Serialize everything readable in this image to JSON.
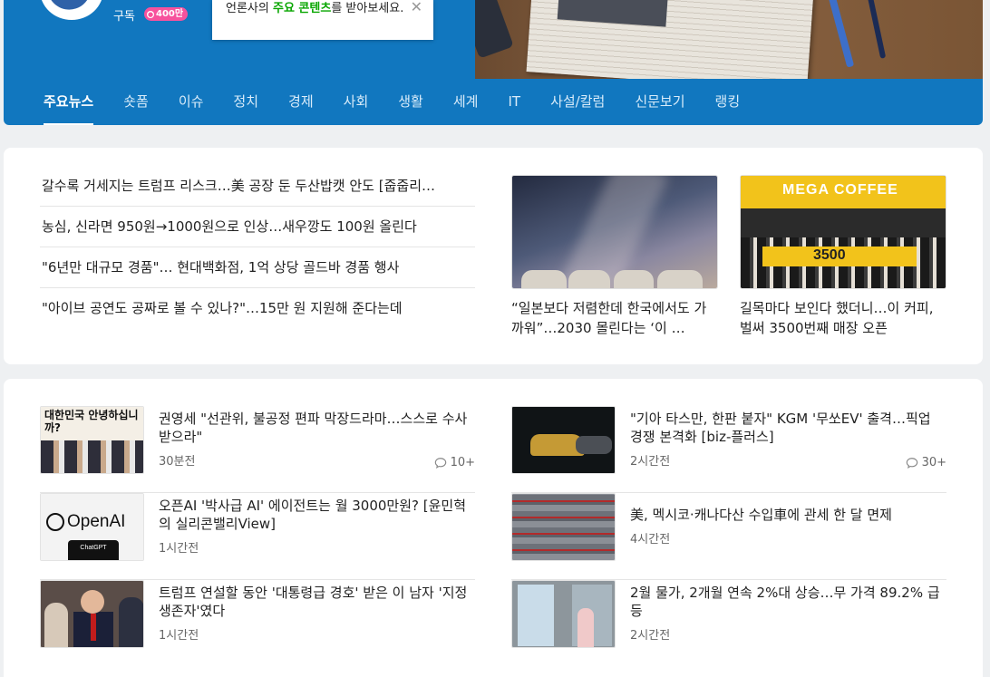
{
  "header": {
    "subscribe_label": "구독",
    "subscriber_count": "400만",
    "tooltip": {
      "prefix": "언론사의 ",
      "highlight": "주요 콘텐츠",
      "suffix": "를 받아보세요."
    },
    "tabs": [
      {
        "label": "주요뉴스",
        "active": true
      },
      {
        "label": "숏폼"
      },
      {
        "label": "이슈"
      },
      {
        "label": "정치"
      },
      {
        "label": "경제"
      },
      {
        "label": "사회"
      },
      {
        "label": "생활"
      },
      {
        "label": "세계"
      },
      {
        "label": "IT"
      },
      {
        "label": "사설/칼럼"
      },
      {
        "label": "신문보기"
      },
      {
        "label": "랭킹"
      }
    ]
  },
  "top_news": {
    "headlines": [
      "갈수록 거세지는 트럼프 리스크…美 공장 둔 두산밥캣 안도 [줍줍리…",
      "농심, 신라면 950원→1000원으로 인상…새우깡도 100원 올린다",
      "\"6년만 대규모 경품\"… 현대백화점, 1억 상당 골드바 경품 행사",
      "\"아이브 공연도 공짜로 볼 수 있나?\"…15만 원 지원해 준다는데"
    ],
    "photo_cards": [
      {
        "caption": "“일본보다 저렴한데 한국에서도 가까워”…2030 몰린다는 ‘이 …"
      },
      {
        "caption": "길목마다 보인다 했더니…이 커피, 벌써 3500번째 매장 오픈",
        "sign": "MEGA COFFEE",
        "banner": "3500"
      }
    ]
  },
  "articles": {
    "left": [
      {
        "title": "권영세 \"선관위, 불공정 편파 막장드라마…스스로 수사 받으라\"",
        "time": "30분전",
        "comments": "10+",
        "thumb_text": "대한민국 안녕하십니까?"
      },
      {
        "title": "오픈AI '박사급 AI' 에이전트는 월 3000만원? [윤민혁의 실리콘밸리View]",
        "time": "1시간전",
        "thumb_logo": "OpenAI",
        "thumb_phone": "ChatGPT"
      },
      {
        "title": "트럼프 연설할 동안 '대통령급 경호' 받은 이 남자 '지정 생존자'였다",
        "time": "1시간전"
      }
    ],
    "right": [
      {
        "title": "\"기아 타스만, 한판 붙자\" KGM '무쏘EV' 출격…픽업 경쟁 본격화 [biz-플러스]",
        "time": "2시간전",
        "comments": "30+"
      },
      {
        "title": "美, 멕시코·캐나다산 수입車에 관세 한 달 면제",
        "time": "4시간전"
      },
      {
        "title": "2월 물가, 2개월 연속 2%대 상승…무 가격 89.2% 급등",
        "time": "2시간전"
      }
    ]
  }
}
